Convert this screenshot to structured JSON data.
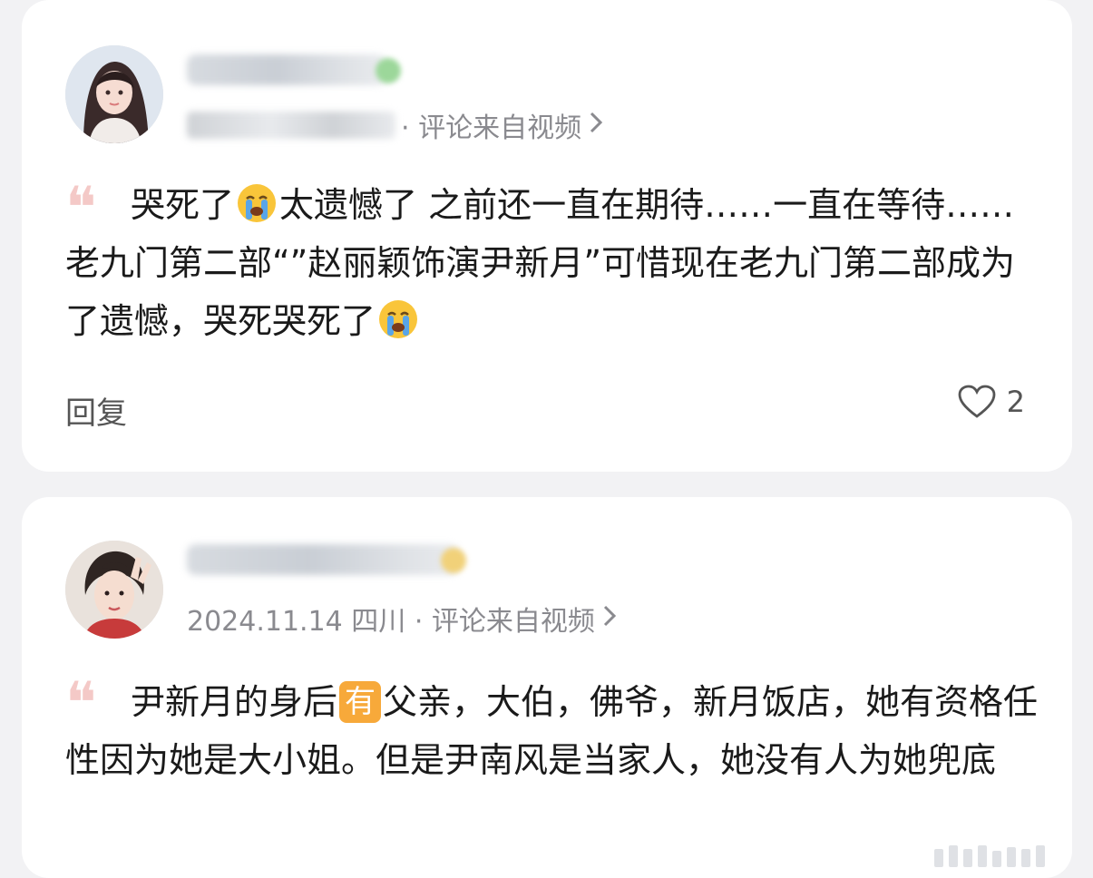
{
  "comments": [
    {
      "meta_visible": "· 评论来自视频",
      "text_parts": [
        "哭死了",
        "太遗憾了 之前还一直在期待……一直在等待……老九门第二部“”赵丽颖饰演尹新月”可惜现在老九门第二部成为了遗憾，哭死哭死了"
      ],
      "emoji": "loudly-crying-face",
      "reply_label": "回复",
      "like_count": "2"
    },
    {
      "meta": "2024.11.14 四川 · 评论来自视频",
      "text_parts": [
        "尹新月的身后",
        "有",
        "父亲，大伯，佛爷，新月饭店，她有资格任性因为她是大小姐。但是尹南风是当家人，她没有人为她兜底"
      ]
    }
  ],
  "colors": {
    "background": "#f2f2f4",
    "card": "#ffffff",
    "quote": "#f4c9c7",
    "meta_text": "#8a8a8f",
    "tag": "#f7a93a"
  }
}
